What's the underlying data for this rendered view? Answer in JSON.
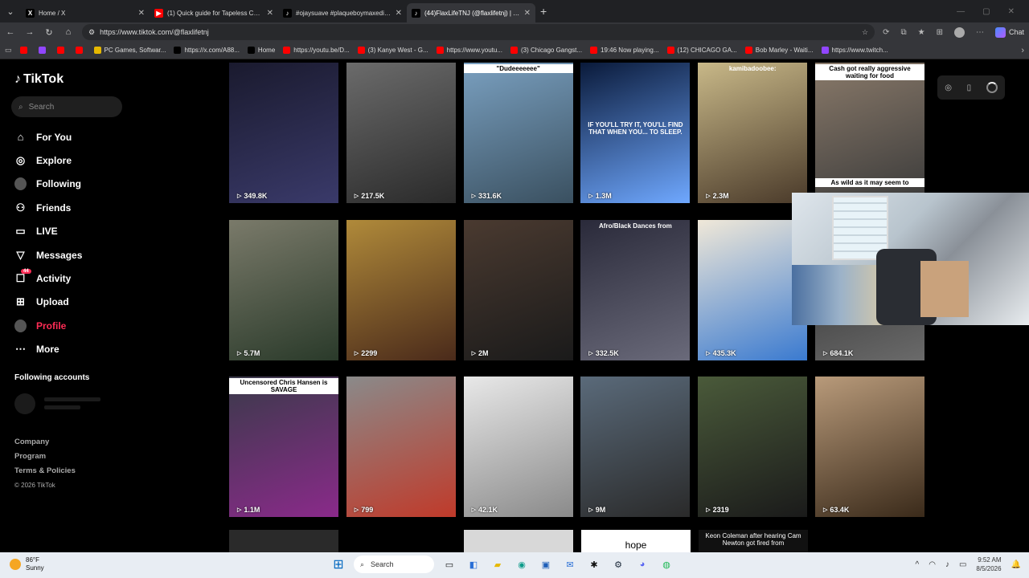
{
  "browser": {
    "tabs": [
      {
        "label": "Home / X",
        "icon": "x-logo-icon",
        "active": false
      },
      {
        "label": "(1) Quick guide for Tapeless Camc",
        "icon": "youtube-icon",
        "active": false
      },
      {
        "label": "#ojaysuave #plaqueboymaxedit #",
        "icon": "tiktok-icon",
        "active": false
      },
      {
        "label": "(44)FlaxLifeTNJ (@flaxlifetnj) | TikT",
        "icon": "tiktok-icon",
        "active": true
      }
    ],
    "url": "https://www.tiktok.com/@flaxlifetnj",
    "chat_label": "Chat",
    "bookmarks": [
      {
        "label": "",
        "icon": "youtube-icon"
      },
      {
        "label": "",
        "icon": "twitch-icon"
      },
      {
        "label": "",
        "icon": "youtube-icon"
      },
      {
        "label": "",
        "icon": "youtube-icon"
      },
      {
        "label": "PC Games, Softwar...",
        "icon": "games-icon"
      },
      {
        "label": "https://x.com/A88...",
        "icon": "x-logo-icon"
      },
      {
        "label": "Home",
        "icon": "x-logo-icon"
      },
      {
        "label": "https://youtu.be/D...",
        "icon": "youtube-icon"
      },
      {
        "label": "(3) Kanye West - G...",
        "icon": "youtube-icon"
      },
      {
        "label": "https://www.youtu...",
        "icon": "youtube-icon"
      },
      {
        "label": "(3) Chicago Gangst...",
        "icon": "youtube-icon"
      },
      {
        "label": "19:46 Now playing...",
        "icon": "youtube-icon"
      },
      {
        "label": "(12) CHICAGO GA...",
        "icon": "youtube-icon"
      },
      {
        "label": "Bob Marley - Waiti...",
        "icon": "youtube-icon"
      },
      {
        "label": "https://www.twitch...",
        "icon": "twitch-icon"
      }
    ]
  },
  "sidebar": {
    "logo": "TikTok",
    "search_placeholder": "Search",
    "items": [
      {
        "label": "For You",
        "icon": "home-icon",
        "active": false
      },
      {
        "label": "Explore",
        "icon": "compass-icon",
        "active": false
      },
      {
        "label": "Following",
        "icon": "following-avatar-icon",
        "active": false
      },
      {
        "label": "Friends",
        "icon": "friends-icon",
        "active": false
      },
      {
        "label": "LIVE",
        "icon": "live-icon",
        "active": false
      },
      {
        "label": "Messages",
        "icon": "messages-icon",
        "active": false
      },
      {
        "label": "Activity",
        "icon": "activity-icon",
        "active": false,
        "badge": "44"
      },
      {
        "label": "Upload",
        "icon": "upload-icon",
        "active": false
      },
      {
        "label": "Profile",
        "icon": "profile-avatar-icon",
        "active": true
      },
      {
        "label": "More",
        "icon": "more-icon",
        "active": false
      }
    ],
    "following_accounts_title": "Following accounts",
    "footer": [
      "Company",
      "Program",
      "Terms & Policies"
    ],
    "copyright": "© 2026 TikTok"
  },
  "videos": [
    {
      "views": "349.8K",
      "colors": [
        "#1a1a2e",
        "#3a3a6a"
      ],
      "caption": ""
    },
    {
      "views": "217.5K",
      "colors": [
        "#6b6b6b",
        "#2a2a2a"
      ],
      "caption": ""
    },
    {
      "views": "331.6K",
      "colors": [
        "#7aa0c0",
        "#3a5060"
      ],
      "caption": "\"Dudeeeeeee\""
    },
    {
      "views": "1.3M",
      "colors": [
        "#0a1a3a",
        "#6fa8ff"
      ],
      "caption": "IF YOU'LL TRY IT, YOU'LL FIND THAT WHEN YOU... TO SLEEP."
    },
    {
      "views": "2.3M",
      "colors": [
        "#c8b888",
        "#4a3a2a"
      ],
      "caption": "kamibadoobee:"
    },
    {
      "views": "",
      "colors": [
        "#8a7a6a",
        "#3a3a3a"
      ],
      "caption": "Cash got really aggressive waiting for food"
    },
    {
      "views": "5.7M",
      "colors": [
        "#7a7a6a",
        "#2a3a2a"
      ],
      "caption": ""
    },
    {
      "views": "2299",
      "colors": [
        "#b08a3a",
        "#4a2a1a"
      ],
      "caption": ""
    },
    {
      "views": "2M",
      "colors": [
        "#4a3a30",
        "#1a1a1a"
      ],
      "caption": ""
    },
    {
      "views": "332.5K",
      "colors": [
        "#2a2a3a",
        "#6a6a7a"
      ],
      "caption": "Afro/Black Dances from"
    },
    {
      "views": "435.3K",
      "colors": [
        "#f0e8d8",
        "#3a7ad0"
      ],
      "caption": ""
    },
    {
      "views": "684.1K",
      "colors": [
        "#2a2a2a",
        "#6a6a6a"
      ],
      "caption": ""
    },
    {
      "views": "1.1M",
      "colors": [
        "#3a3a4a",
        "#8a2a8a"
      ],
      "caption": "Uncensored Chris Hansen is SAVAGE"
    },
    {
      "views": "799",
      "colors": [
        "#8a8a8a",
        "#c03a2a"
      ],
      "caption": ""
    },
    {
      "views": "42.1K",
      "colors": [
        "#e8e8e8",
        "#8a8a8a"
      ],
      "caption": ""
    },
    {
      "views": "9M",
      "colors": [
        "#5a6a7a",
        "#2a2a2a"
      ],
      "caption": ""
    },
    {
      "views": "2319",
      "colors": [
        "#4a5a3a",
        "#1a1a1a"
      ],
      "caption": ""
    },
    {
      "views": "63.4K",
      "colors": [
        "#b89a7a",
        "#3a2a1a"
      ],
      "caption": ""
    }
  ],
  "pip_caption": "As wild as it may seem to",
  "bottom_row": {
    "hope": "hope",
    "keon": "Keon Coleman after hearing Cam Newton got fired from"
  },
  "taskbar": {
    "temperature": "86°F",
    "condition": "Sunny",
    "search_label": "Search",
    "time": "9:52 AM",
    "date": "8/5/2026"
  }
}
